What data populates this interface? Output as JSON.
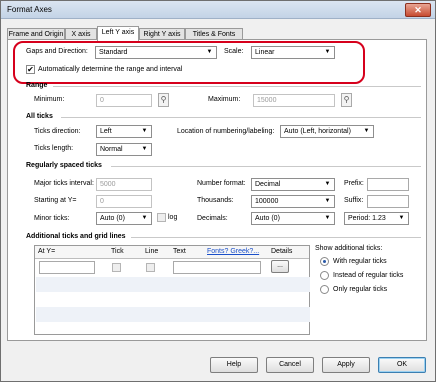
{
  "window": {
    "title": "Format Axes",
    "close_glyph": "✕"
  },
  "tabs": [
    {
      "label": "Frame and Origin",
      "active": false
    },
    {
      "label": "X axis",
      "active": false
    },
    {
      "label": "Left Y axis",
      "active": true
    },
    {
      "label": "Right Y axis",
      "active": false
    },
    {
      "label": "Titles & Fonts",
      "active": false
    }
  ],
  "gaps": {
    "label": "Gaps and Direction:",
    "value": "Standard",
    "scale_label": "Scale:",
    "scale_value": "Linear",
    "auto_checkbox_label": "Automatically determine the range and interval",
    "auto_checked": true
  },
  "range": {
    "heading": "Range",
    "minimum_label": "Minimum:",
    "minimum_value": "0",
    "maximum_label": "Maximum:",
    "maximum_value": "15000"
  },
  "all_ticks": {
    "heading": "All ticks",
    "direction_label": "Ticks direction:",
    "direction_value": "Left",
    "location_label": "Location of numbering/labeling:",
    "location_value": "Auto (Left, horizontal)",
    "length_label": "Ticks length:",
    "length_value": "Normal"
  },
  "regular": {
    "heading": "Regularly spaced ticks",
    "major_label": "Major ticks interval:",
    "major_value": "5000",
    "starting_label": "Starting at Y=",
    "starting_value": "0",
    "minor_label": "Minor ticks:",
    "minor_value": "Auto (0)",
    "log_label": "log",
    "number_format_label": "Number format:",
    "number_format_value": "Decimal",
    "thousands_label": "Thousands:",
    "thousands_value": "100000",
    "decimals_label": "Decimals:",
    "decimals_value": "Auto (0)",
    "prefix_label": "Prefix:",
    "suffix_label": "Suffix:",
    "period_value": "Period: 1.23"
  },
  "additional": {
    "heading": "Additional ticks and grid lines",
    "columns": [
      "At Y=",
      "Tick",
      "Line",
      "Text",
      "Details"
    ],
    "fonts_link": "Fonts? Greek?...",
    "details_button": "...",
    "show_label": "Show additional ticks:",
    "options": [
      {
        "label": "With regular ticks",
        "selected": true
      },
      {
        "label": "Instead of regular ticks",
        "selected": false
      },
      {
        "label": "Only regular ticks",
        "selected": false
      }
    ]
  },
  "buttons": {
    "help": "Help",
    "cancel": "Cancel",
    "apply": "Apply",
    "ok": "OK"
  },
  "icons": {
    "dropdown_arrow": "▼",
    "pin_icon": "⚲",
    "check": "✔"
  }
}
